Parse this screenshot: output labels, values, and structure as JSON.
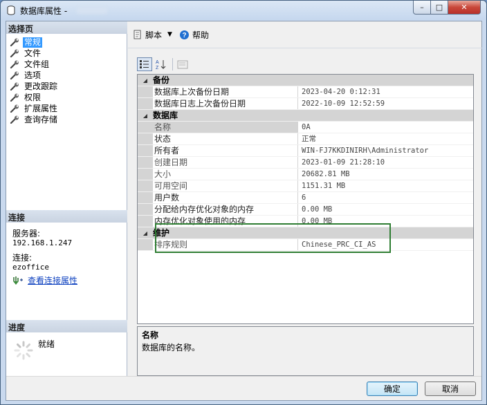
{
  "window": {
    "title": "数据库属性 -",
    "controls": {
      "minimize": "–",
      "maximize": "□",
      "close": "✕"
    }
  },
  "left_panel": {
    "select_page_header": "选择页",
    "pages": [
      {
        "label": "常规",
        "selected": true
      },
      {
        "label": "文件",
        "selected": false
      },
      {
        "label": "文件组",
        "selected": false
      },
      {
        "label": "选项",
        "selected": false
      },
      {
        "label": "更改跟踪",
        "selected": false
      },
      {
        "label": "权限",
        "selected": false
      },
      {
        "label": "扩展属性",
        "selected": false
      },
      {
        "label": "查询存储",
        "selected": false
      }
    ],
    "connection_header": "连接",
    "server_label": "服务器:",
    "server_value": "192.168.1.247",
    "connection_label": "连接:",
    "connection_value": "ezoffice",
    "view_connection_link": "查看连接属性",
    "progress_header": "进度",
    "progress_status": "就绪"
  },
  "toolbar": {
    "script_label": "脚本",
    "help_label": "帮助"
  },
  "property_grid": {
    "categories": [
      {
        "name": "备份",
        "rows": [
          {
            "name": "数据库上次备份日期",
            "value": "2023-04-20 0:12:31"
          },
          {
            "name": "数据库日志上次备份日期",
            "value": "2022-10-09 12:52:59"
          }
        ]
      },
      {
        "name": "数据库",
        "rows": [
          {
            "name": "名称",
            "value": "0A"
          },
          {
            "name": "状态",
            "value": "正常"
          },
          {
            "name": "所有者",
            "value": "WIN-FJ7KKDINIRH\\Administrator"
          },
          {
            "name": "创建日期",
            "value": "2023-01-09 21:28:10"
          },
          {
            "name": "大小",
            "value": "20682.81 MB"
          },
          {
            "name": "可用空间",
            "value": "1151.31 MB"
          },
          {
            "name": "用户数",
            "value": "6"
          },
          {
            "name": "分配给内存优化对象的内存",
            "value": "0.00 MB"
          },
          {
            "name": "内存优化对象使用的内存",
            "value": "0.00 MB"
          }
        ]
      },
      {
        "name": "维护",
        "rows": [
          {
            "name": "排序规则",
            "value": "Chinese_PRC_CI_AS"
          }
        ]
      }
    ]
  },
  "description": {
    "title": "名称",
    "text": "数据库的名称。"
  },
  "buttons": {
    "ok": "确定",
    "cancel": "取消"
  },
  "colors": {
    "selection": "#3399ff",
    "highlight_box": "#2e7d32",
    "category_bg": "#d4d4d4"
  }
}
